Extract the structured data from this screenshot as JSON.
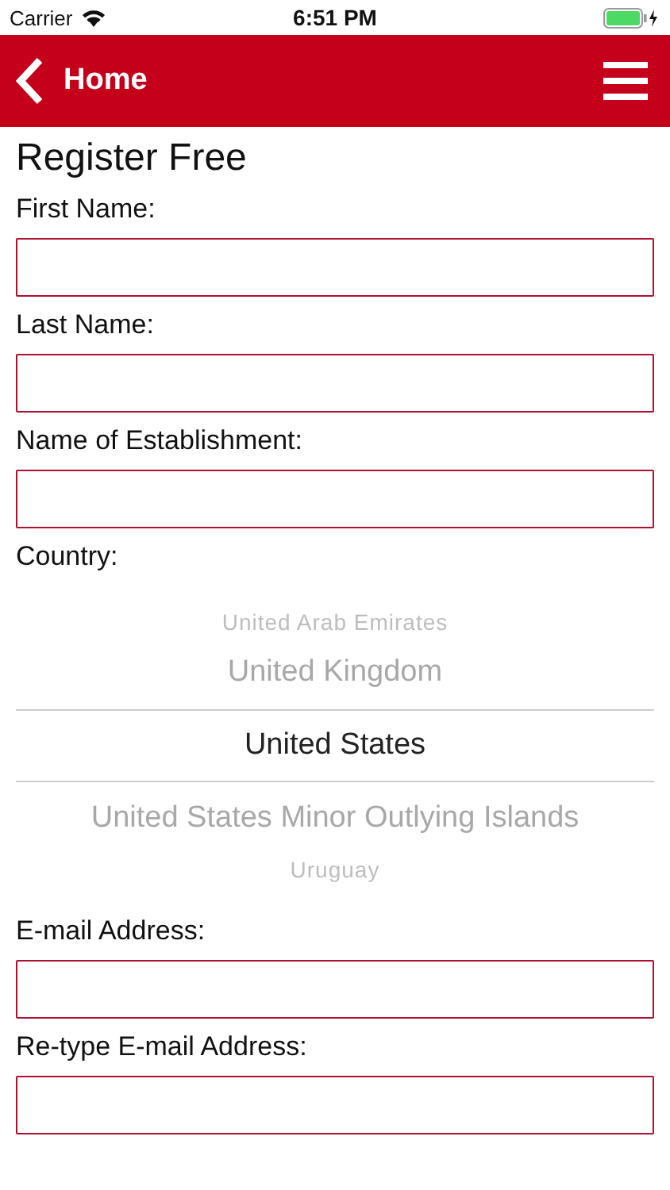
{
  "status_bar": {
    "carrier": "Carrier",
    "time": "6:51 PM"
  },
  "nav_bar": {
    "back_label": "Home"
  },
  "title": "Register Free",
  "fields_top": [
    {
      "label": "First Name:"
    },
    {
      "label": "Last Name:"
    },
    {
      "label": "Name of Establishment:"
    }
  ],
  "country": {
    "label": "Country:",
    "options": [
      {
        "name": "United Arab Emirates",
        "selected": false
      },
      {
        "name": "United Kingdom",
        "selected": false
      },
      {
        "name": "United States",
        "selected": true
      },
      {
        "name": "United States Minor Outlying Islands",
        "selected": false
      },
      {
        "name": "Uruguay",
        "selected": false
      }
    ]
  },
  "fields_bottom": [
    {
      "label": "E-mail Address:"
    },
    {
      "label": "Re-type E-mail Address:"
    }
  ]
}
